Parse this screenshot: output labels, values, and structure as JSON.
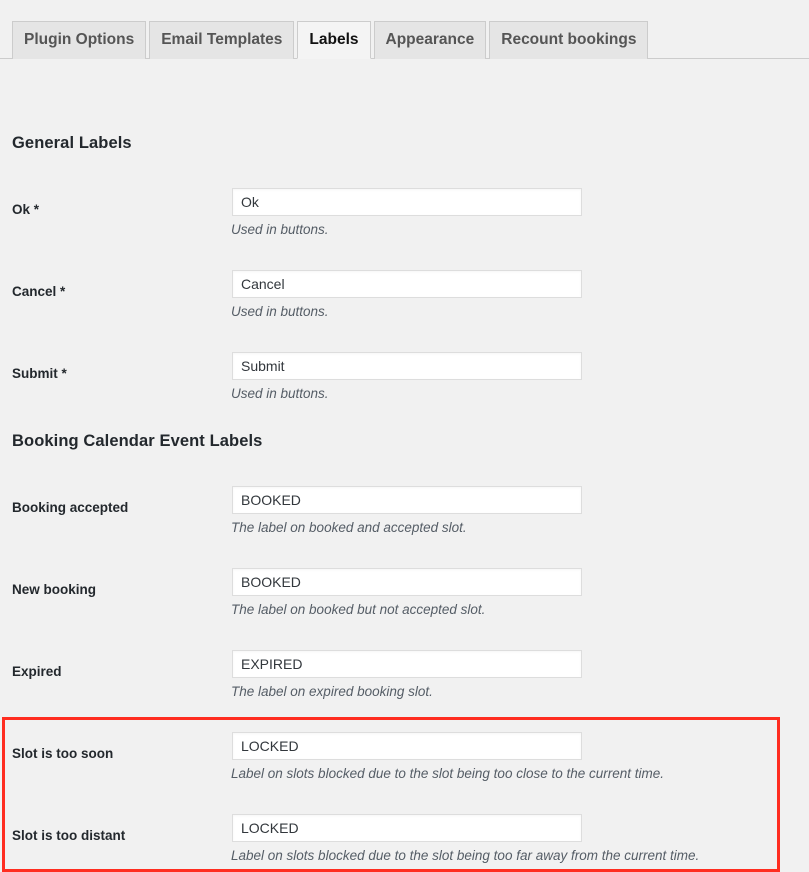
{
  "tabs": [
    {
      "label": "Plugin Options",
      "active": false
    },
    {
      "label": "Email Templates",
      "active": false
    },
    {
      "label": "Labels",
      "active": true
    },
    {
      "label": "Appearance",
      "active": false
    },
    {
      "label": "Recount bookings",
      "active": false
    }
  ],
  "sections": {
    "general": {
      "title": "General Labels"
    },
    "booking": {
      "title": "Booking Calendar Event Labels"
    }
  },
  "fields": [
    {
      "label": "Ok *",
      "value": "Ok",
      "desc": "Used in buttons."
    },
    {
      "label": "Cancel *",
      "value": "Cancel",
      "desc": "Used in buttons."
    },
    {
      "label": "Submit *",
      "value": "Submit",
      "desc": "Used in buttons."
    },
    {
      "label": "Booking accepted",
      "value": "BOOKED",
      "desc": "The label on booked and accepted slot."
    },
    {
      "label": "New booking",
      "value": "BOOKED",
      "desc": "The label on booked but not accepted slot."
    },
    {
      "label": "Expired",
      "value": "EXPIRED",
      "desc": "The label on expired booking slot."
    },
    {
      "label": "Slot is too soon",
      "value": "LOCKED",
      "desc": "Label on slots blocked due to the slot being too close to the current time."
    },
    {
      "label": "Slot is too distant",
      "value": "LOCKED",
      "desc": "Label on slots blocked due to the slot being too far away from the current time."
    }
  ],
  "annotation": {
    "color": "#ff2d20"
  }
}
